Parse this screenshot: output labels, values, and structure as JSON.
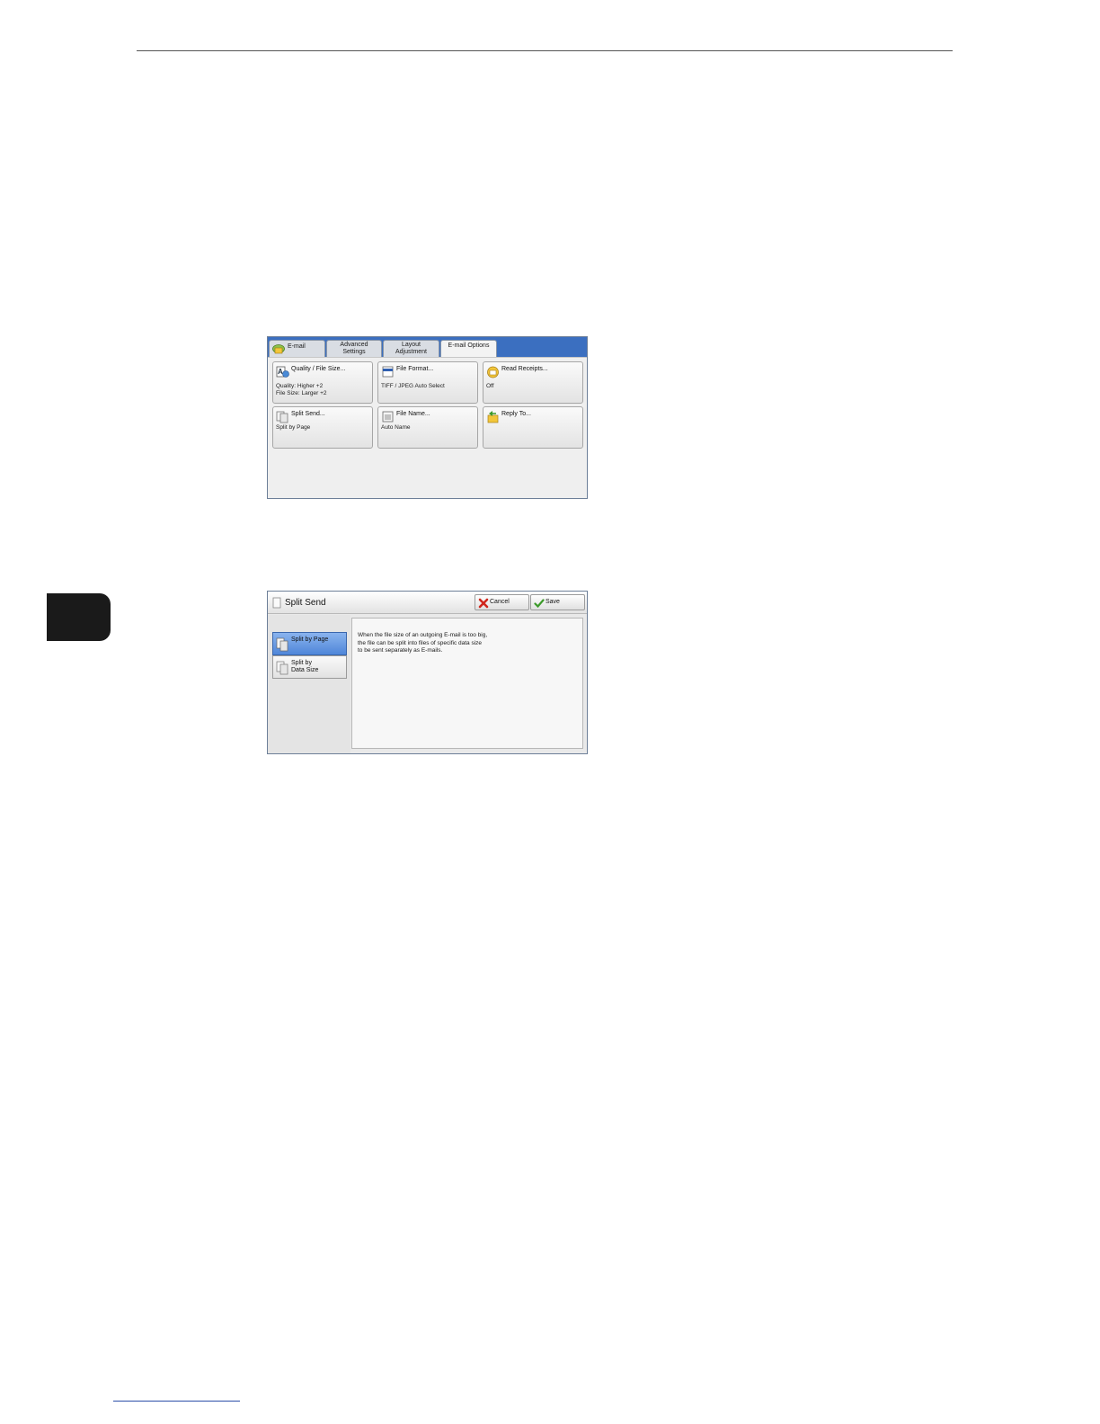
{
  "screen1": {
    "tabs": [
      {
        "label": "E-mail"
      },
      {
        "label_lines": [
          "Advanced",
          "Settings"
        ]
      },
      {
        "label_lines": [
          "Layout",
          "Adjustment"
        ]
      },
      {
        "label": "E-mail Options"
      }
    ],
    "features": [
      {
        "title": "Quality / File Size...",
        "value_lines": [
          "Quality: Higher +2",
          "File Size: Larger +2"
        ],
        "icon": "quality-icon"
      },
      {
        "title": "File Format...",
        "value_lines": [
          "TIFF / JPEG Auto Select"
        ],
        "icon": "file-format-icon"
      },
      {
        "title": "Read Receipts...",
        "value_lines": [
          "Off"
        ],
        "icon": "read-receipt-icon"
      },
      {
        "title": "Split Send...",
        "value_lines": [
          "Split by Page"
        ],
        "icon": "split-send-icon"
      },
      {
        "title": "File Name...",
        "value_lines": [
          "Auto Name"
        ],
        "icon": "file-name-icon"
      },
      {
        "title": "Reply To...",
        "value_lines": [],
        "icon": "reply-to-icon"
      }
    ]
  },
  "screen2": {
    "title": "Split Send",
    "cancel_label": "Cancel",
    "save_label": "Save",
    "options": [
      {
        "label": "Split by Page",
        "selected": true
      },
      {
        "label": "Split by\nData Size",
        "selected": false
      }
    ],
    "description_lines": [
      "When the file size of an outgoing E-mail is too big,",
      "the file can be split into files of specific data size",
      "to be sent separately as E-mails."
    ]
  },
  "colors": {
    "tab_bar": "#3b6fc0",
    "selected_option": "#4f86d9",
    "chapter_tab": "#1a1a1a",
    "cancel_icon": "#d0261d",
    "save_icon": "#3c9a2a"
  }
}
